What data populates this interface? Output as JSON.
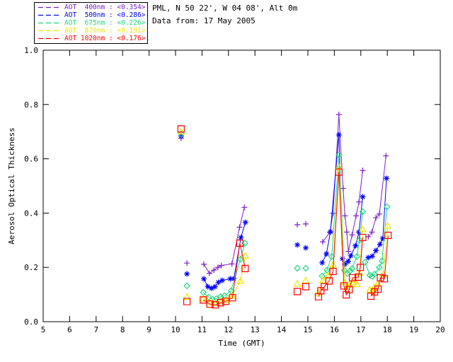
{
  "header": {
    "station_line": "PML, N 50 22', W 04 08', Alt 0m",
    "date_line": "Data from: 17 May 2005"
  },
  "legend": {
    "entries": [
      {
        "id": "400nm",
        "label": "AOT  400nm : <0.354>",
        "mean": "<0.354>",
        "color": "#7D1EC8"
      },
      {
        "id": "500nm",
        "label": "AOT  500nm : <0.286>",
        "mean": "<0.286>",
        "color": "#0000FF"
      },
      {
        "id": "675nm",
        "label": "AOT  675nm : <0.226>",
        "mean": "<0.226>",
        "color": "#1FD781"
      },
      {
        "id": "870nm",
        "label": "AOT  870nm : <0.191>",
        "mean": "<0.191>",
        "color": "#EDE400"
      },
      {
        "id": "1020nm",
        "label": "AOT 1020nm : <0.176>",
        "mean": "<0.176>",
        "color": "#FF0000"
      }
    ]
  },
  "chart_data": {
    "type": "scatter",
    "title": "",
    "xlabel": "Time (GMT)",
    "ylabel": "Aerosol Optical Thickness",
    "xlim": [
      5,
      20
    ],
    "ylim": [
      0.0,
      1.0
    ],
    "xticks": [
      5,
      6,
      7,
      8,
      9,
      10,
      11,
      12,
      13,
      14,
      15,
      16,
      17,
      18,
      19,
      20
    ],
    "yticks": [
      0.0,
      0.2,
      0.4,
      0.6,
      0.8,
      1.0
    ],
    "grid": false,
    "legend_position": "top-left-outside",
    "series": [
      {
        "name": "AOT 400nm",
        "wavelength": 400,
        "color": "#7D1EC8",
        "marker": "plus",
        "segments": [
          [
            [
              10.21,
              0.676
            ]
          ],
          [
            [
              10.43,
              0.216
            ]
          ],
          [
            [
              11.07,
              0.212
            ],
            [
              11.28,
              0.178
            ],
            [
              11.45,
              0.19
            ],
            [
              11.6,
              0.2
            ],
            [
              11.73,
              0.207
            ],
            [
              12.13,
              0.213
            ],
            [
              12.42,
              0.348
            ],
            [
              12.6,
              0.421
            ]
          ],
          [
            [
              14.6,
              0.357
            ]
          ],
          [
            [
              14.92,
              0.36
            ]
          ],
          [
            [
              15.56,
              0.294
            ],
            [
              15.83,
              0.329
            ],
            [
              15.95,
              0.399
            ],
            [
              16.17,
              0.763
            ],
            [
              16.33,
              0.491
            ],
            [
              16.4,
              0.39
            ],
            [
              16.47,
              0.33
            ],
            [
              16.53,
              0.259
            ],
            [
              16.67,
              0.32
            ],
            [
              16.82,
              0.39
            ],
            [
              16.93,
              0.441
            ],
            [
              17.07,
              0.557
            ]
          ],
          [
            [
              17.28,
              0.313
            ],
            [
              17.42,
              0.33
            ],
            [
              17.57,
              0.383
            ],
            [
              17.7,
              0.397
            ],
            [
              17.95,
              0.611
            ]
          ]
        ]
      },
      {
        "name": "AOT 500nm",
        "wavelength": 500,
        "color": "#0000FF",
        "marker": "asterisk",
        "segments": [
          [
            [
              10.21,
              0.684
            ]
          ],
          [
            [
              10.43,
              0.176
            ]
          ],
          [
            [
              11.07,
              0.158
            ],
            [
              11.22,
              0.129
            ],
            [
              11.36,
              0.123
            ],
            [
              11.49,
              0.129
            ],
            [
              11.62,
              0.145
            ],
            [
              11.76,
              0.152
            ],
            [
              12.07,
              0.158
            ],
            [
              12.2,
              0.158
            ],
            [
              12.47,
              0.31
            ],
            [
              12.64,
              0.366
            ]
          ],
          [
            [
              14.6,
              0.283
            ]
          ],
          [
            [
              14.92,
              0.272
            ]
          ],
          [
            [
              15.54,
              0.217
            ],
            [
              15.7,
              0.25
            ],
            [
              15.85,
              0.331
            ],
            [
              16.17,
              0.688
            ],
            [
              16.31,
              0.232
            ],
            [
              16.4,
              0.212
            ],
            [
              16.52,
              0.222
            ],
            [
              16.62,
              0.243
            ],
            [
              16.8,
              0.28
            ],
            [
              16.93,
              0.33
            ],
            [
              17.07,
              0.46
            ]
          ],
          [
            [
              17.28,
              0.236
            ],
            [
              17.43,
              0.241
            ],
            [
              17.57,
              0.262
            ],
            [
              17.72,
              0.285
            ],
            [
              17.83,
              0.307
            ],
            [
              17.97,
              0.528
            ]
          ]
        ]
      },
      {
        "name": "AOT 675nm",
        "wavelength": 675,
        "color": "#1FD781",
        "marker": "diamond",
        "segments": [
          [
            [
              10.21,
              0.692
            ]
          ],
          [
            [
              10.43,
              0.132
            ]
          ],
          [
            [
              11.05,
              0.108
            ],
            [
              11.25,
              0.09
            ],
            [
              11.4,
              0.082
            ],
            [
              11.55,
              0.085
            ],
            [
              11.7,
              0.092
            ],
            [
              11.85,
              0.096
            ],
            [
              12.1,
              0.114
            ],
            [
              12.45,
              0.23
            ],
            [
              12.62,
              0.289
            ]
          ],
          [
            [
              14.6,
              0.197
            ]
          ],
          [
            [
              14.92,
              0.197
            ]
          ],
          [
            [
              15.54,
              0.168
            ],
            [
              15.72,
              0.19
            ],
            [
              15.9,
              0.24
            ],
            [
              16.17,
              0.614
            ],
            [
              16.38,
              0.189
            ],
            [
              16.49,
              0.178
            ],
            [
              16.6,
              0.187
            ],
            [
              16.67,
              0.196
            ],
            [
              16.85,
              0.24
            ],
            [
              16.95,
              0.3
            ],
            [
              17.07,
              0.405
            ]
          ],
          [
            [
              17.16,
              0.219
            ],
            [
              17.34,
              0.171
            ],
            [
              17.43,
              0.167
            ],
            [
              17.52,
              0.175
            ],
            [
              17.7,
              0.2
            ],
            [
              17.8,
              0.224
            ],
            [
              17.99,
              0.423
            ]
          ]
        ]
      },
      {
        "name": "AOT 870nm",
        "wavelength": 870,
        "color": "#EDE400",
        "marker": "triangle",
        "segments": [
          [
            [
              10.21,
              0.7
            ]
          ],
          [
            [
              10.43,
              0.091
            ]
          ],
          [
            [
              11.05,
              0.085
            ],
            [
              11.3,
              0.072
            ],
            [
              11.5,
              0.068
            ],
            [
              11.7,
              0.075
            ],
            [
              11.9,
              0.08
            ],
            [
              12.15,
              0.095
            ],
            [
              12.45,
              0.15
            ],
            [
              12.64,
              0.243
            ]
          ],
          [
            [
              14.6,
              0.14
            ]
          ],
          [
            [
              14.92,
              0.152
            ]
          ],
          [
            [
              15.4,
              0.105
            ],
            [
              15.57,
              0.152
            ],
            [
              15.75,
              0.17
            ],
            [
              15.95,
              0.21
            ],
            [
              16.17,
              0.57
            ],
            [
              16.4,
              0.145
            ],
            [
              16.47,
              0.127
            ],
            [
              16.58,
              0.136
            ],
            [
              16.69,
              0.147
            ],
            [
              16.85,
              0.138
            ],
            [
              16.95,
              0.18
            ],
            [
              17.07,
              0.34
            ]
          ],
          [
            [
              17.34,
              0.118
            ],
            [
              17.43,
              0.114
            ],
            [
              17.52,
              0.127
            ],
            [
              17.65,
              0.14
            ],
            [
              17.85,
              0.176
            ],
            [
              18.01,
              0.353
            ]
          ]
        ]
      },
      {
        "name": "AOT 1020nm",
        "wavelength": 1020,
        "color": "#FF0000",
        "marker": "square",
        "segments": [
          [
            [
              10.21,
              0.71
            ]
          ],
          [
            [
              10.43,
              0.074
            ]
          ],
          [
            [
              11.05,
              0.08
            ],
            [
              11.3,
              0.065
            ],
            [
              11.5,
              0.062
            ],
            [
              11.7,
              0.07
            ],
            [
              11.9,
              0.075
            ],
            [
              12.15,
              0.088
            ],
            [
              12.43,
              0.289
            ],
            [
              12.63,
              0.196
            ]
          ],
          [
            [
              14.6,
              0.111
            ]
          ],
          [
            [
              14.92,
              0.129
            ]
          ],
          [
            [
              15.4,
              0.092
            ],
            [
              15.49,
              0.114
            ],
            [
              15.62,
              0.129
            ],
            [
              15.8,
              0.15
            ],
            [
              15.95,
              0.185
            ],
            [
              16.17,
              0.551
            ],
            [
              16.36,
              0.132
            ],
            [
              16.45,
              0.099
            ],
            [
              16.56,
              0.118
            ],
            [
              16.69,
              0.162
            ],
            [
              16.9,
              0.164
            ],
            [
              16.98,
              0.2
            ],
            [
              17.07,
              0.31
            ]
          ],
          [
            [
              17.38,
              0.094
            ],
            [
              17.52,
              0.11
            ],
            [
              17.65,
              0.12
            ],
            [
              17.74,
              0.162
            ],
            [
              17.89,
              0.158
            ],
            [
              18.03,
              0.318
            ]
          ]
        ]
      }
    ]
  }
}
